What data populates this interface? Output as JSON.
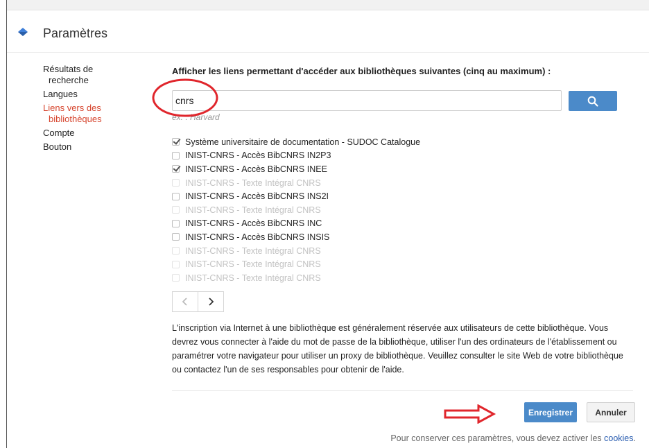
{
  "header": {
    "title": "Paramètres"
  },
  "sidebar": {
    "items": [
      {
        "line1": "Résultats de",
        "line2": "recherche",
        "active": false
      },
      {
        "line1": "Langues",
        "active": false
      },
      {
        "line1": "Liens vers des",
        "line2": "bibliothèques",
        "active": true
      },
      {
        "line1": "Compte",
        "active": false
      },
      {
        "line1": "Bouton",
        "active": false
      }
    ]
  },
  "main": {
    "heading": "Afficher les liens permettant d'accéder aux bibliothèques suivantes (cinq au maximum) :",
    "search": {
      "value": "cnrs",
      "hint": "ex. : Harvard"
    },
    "libraries": [
      {
        "label": "Système universitaire de documentation - SUDOC Catalogue",
        "checked": true,
        "disabled": false
      },
      {
        "label": "INIST-CNRS - Accès BibCNRS IN2P3",
        "checked": false,
        "disabled": false
      },
      {
        "label": "INIST-CNRS - Accès BibCNRS INEE",
        "checked": true,
        "disabled": false
      },
      {
        "label": "INIST-CNRS - Texte Intégral CNRS",
        "checked": false,
        "disabled": true
      },
      {
        "label": "INIST-CNRS - Accès BibCNRS INS2I",
        "checked": false,
        "disabled": false
      },
      {
        "label": "INIST-CNRS - Texte Intégral CNRS",
        "checked": false,
        "disabled": true
      },
      {
        "label": "INIST-CNRS - Accès BibCNRS INC",
        "checked": false,
        "disabled": false
      },
      {
        "label": "INIST-CNRS - Accès BibCNRS INSIS",
        "checked": false,
        "disabled": false
      },
      {
        "label": "INIST-CNRS - Texte Intégral CNRS",
        "checked": false,
        "disabled": true
      },
      {
        "label": "INIST-CNRS - Texte Intégral CNRS",
        "checked": false,
        "disabled": true
      },
      {
        "label": "INIST-CNRS - Texte Intégral CNRS",
        "checked": false,
        "disabled": true
      }
    ],
    "info_text": "L'inscription via Internet à une bibliothèque est généralement réservée aux utilisateurs de cette bibliothèque. Vous devrez vous connecter à l'aide du mot de passe de la bibliothèque, utiliser l'un des ordinateurs de l'établissement ou paramétrer votre navigateur pour utiliser un proxy de bibliothèque. Veuillez consulter le site Web de votre bibliothèque ou contactez l'un de ses responsables pour obtenir de l'aide.",
    "save_label": "Enregistrer",
    "cancel_label": "Annuler",
    "footer_note": "Pour conserver ces paramètres, vous devez activer les",
    "footer_link": "cookies",
    "footer_end": "."
  },
  "icons": {
    "logo": "scholar-logo-icon",
    "search": "search-icon",
    "prev": "chevron-left-icon",
    "next": "chevron-right-icon"
  },
  "colors": {
    "accent": "#4b8ac9",
    "active_nav": "#d6452e",
    "annotation": "#e0262c"
  }
}
